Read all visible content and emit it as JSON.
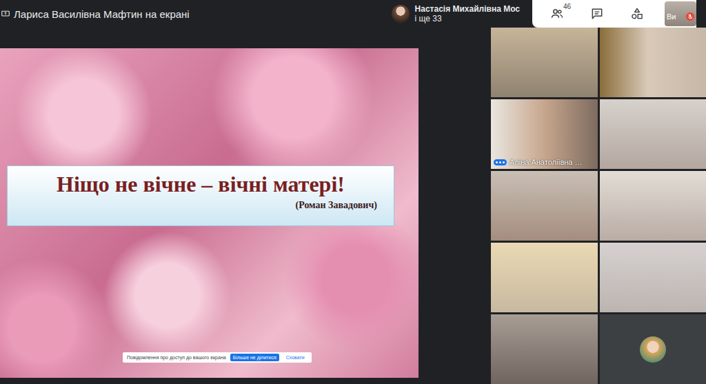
{
  "presenter": {
    "label": "Лариса Василівна Мафтин на екрані"
  },
  "pinned": {
    "name": "Настасія Михайлівна Мос",
    "others": "і ще 33"
  },
  "toolbar": {
    "participants_count": "46"
  },
  "self": {
    "label": "Ви",
    "muted": true
  },
  "slide": {
    "quote": "Ніщо не вічне – вічні матері!",
    "author": "(Роман Завадович)"
  },
  "share_notice": {
    "text": "Повідомлення про доступ до вашого екрана",
    "buttons": [
      {
        "label": "Більше не ділитися",
        "primary": true
      },
      {
        "label": "Сховати",
        "primary": false
      }
    ]
  },
  "tiles": [
    {
      "kind": "video",
      "name": "",
      "speaking": false
    },
    {
      "kind": "video",
      "name": "",
      "speaking": false
    },
    {
      "kind": "video",
      "name": "Аліна Анатоліївна …",
      "speaking": true
    },
    {
      "kind": "video",
      "name": "",
      "speaking": false
    },
    {
      "kind": "video",
      "name": "",
      "speaking": false
    },
    {
      "kind": "video",
      "name": "",
      "speaking": false
    },
    {
      "kind": "video",
      "name": "",
      "speaking": false
    },
    {
      "kind": "video",
      "name": "",
      "speaking": false
    },
    {
      "kind": "video",
      "name": "",
      "speaking": false
    },
    {
      "kind": "avatar",
      "name": "",
      "speaking": false
    }
  ]
}
